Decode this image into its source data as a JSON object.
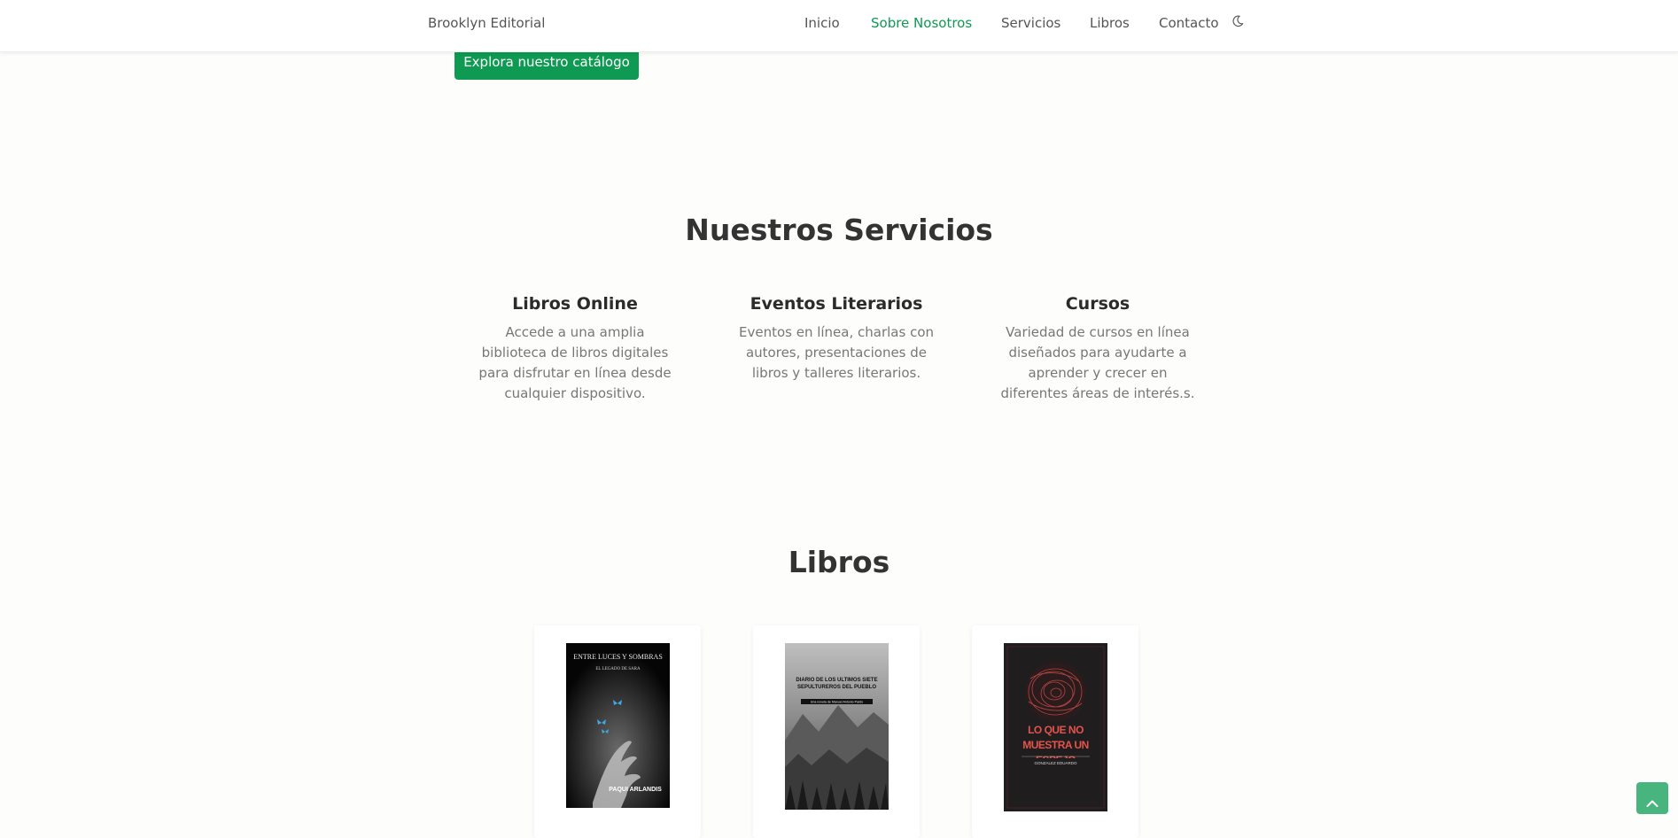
{
  "navbar": {
    "brand": "Brooklyn Editorial",
    "links": [
      {
        "label": "Inicio",
        "active": false
      },
      {
        "label": "Sobre Nosotros",
        "active": true
      },
      {
        "label": "Servicios",
        "active": false
      },
      {
        "label": "Libros",
        "active": false
      },
      {
        "label": "Contacto",
        "active": false
      }
    ],
    "theme_icon": "moon-icon"
  },
  "hero": {
    "cta_label": "Explora nuestro catálogo"
  },
  "services": {
    "title": "Nuestros Servicios",
    "items": [
      {
        "title": "Libros Online",
        "description": "Accede a una amplia biblioteca de libros digitales para disfrutar en línea desde cualquier dispositivo."
      },
      {
        "title": "Eventos Literarios",
        "description": "Eventos en línea, charlas con autores, presentaciones de libros y talleres literarios."
      },
      {
        "title": "Cursos",
        "description": "Variedad de cursos en línea diseñados para ayudarte a aprender y crecer en diferentes áreas de interés.s."
      }
    ]
  },
  "books": {
    "title": "Libros",
    "items": [
      {
        "cover_title": "ENTRE LUCES Y SOMBRAS",
        "cover_subtitle": "EL LEGADO DE SARA",
        "cover_author": "PAQUI ARLANDIS"
      },
      {
        "cover_title": "DIARIO DE LOS ÚLTIMOS SIETE SEPULTUREROS DEL PUEBLO",
        "cover_subtitle": "Una novela de Manuel Antonio Pardo",
        "cover_author": ""
      },
      {
        "cover_title": "LO QUE NO MUESTRA UN ESPEJO",
        "cover_subtitle": "",
        "cover_author": "GONZALEZ EDUARDO"
      }
    ]
  },
  "colors": {
    "accent": "#0e9a52",
    "scroll_button": "#48b57e",
    "background": "#fdfdfc"
  },
  "scroll_top_icon": "chevron-up-icon"
}
